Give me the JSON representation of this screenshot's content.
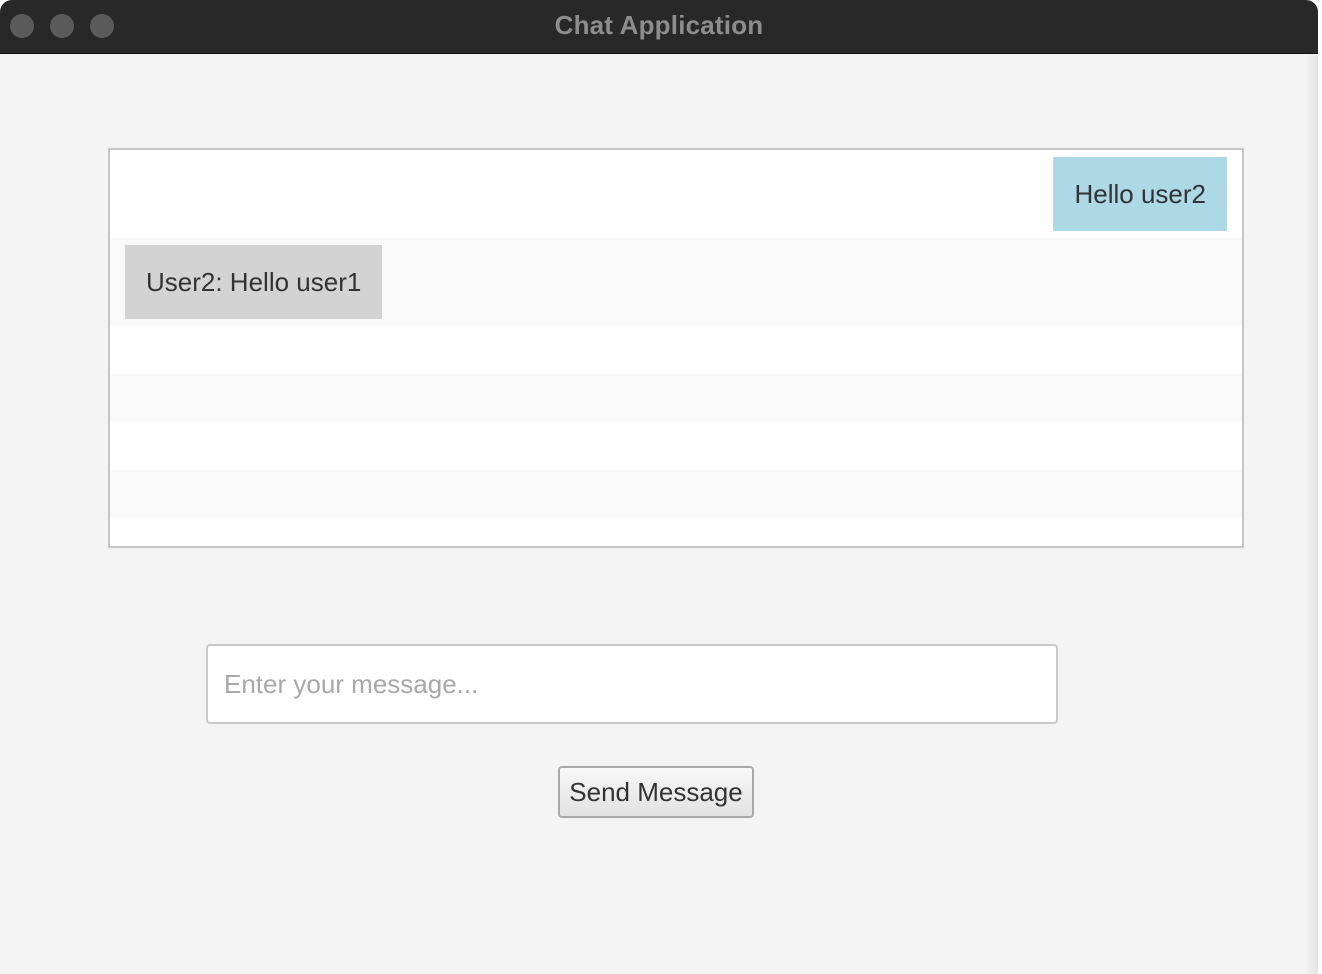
{
  "window": {
    "title": "Chat Application"
  },
  "chat": {
    "messages": [
      {
        "text": "Hello user2",
        "direction": "sent",
        "color": "#add8e6"
      },
      {
        "text": "User2: Hello user1",
        "direction": "received",
        "color": "#d3d3d3"
      }
    ],
    "empty_rows": 5
  },
  "composer": {
    "placeholder": "Enter your message...",
    "value": "",
    "send_label": "Send Message"
  }
}
